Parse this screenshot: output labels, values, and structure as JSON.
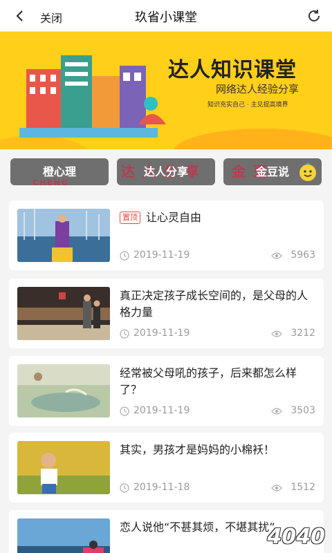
{
  "header": {
    "close_label": "关闭",
    "title": "玖省小课堂"
  },
  "banner": {
    "headline": "达人知识课堂",
    "subtitle": "网络达人经验分享",
    "tagline": "知识充实自己 · 主见提高境界"
  },
  "tabs": [
    {
      "label": "橙心理",
      "ghost": "CHENG"
    },
    {
      "label": "达人分享",
      "ghost": "达 人 分 享"
    },
    {
      "label": "金豆说",
      "ghost": "金 豆"
    }
  ],
  "articles": [
    {
      "pinned": true,
      "pin_label": "置顶",
      "title": "让心灵自由",
      "date": "2019-11-19",
      "views": "5963"
    },
    {
      "pinned": false,
      "title": "真正决定孩子成长空间的，是父母的人格力量",
      "date": "2019-11-19",
      "views": "3212"
    },
    {
      "pinned": false,
      "title": "经常被父母吼的孩子，后来都怎么样了？",
      "date": "2019-11-19",
      "views": "3503"
    },
    {
      "pinned": false,
      "title": "其实，男孩才是妈妈的小棉袄！",
      "date": "2019-11-18",
      "views": "1512"
    },
    {
      "pinned": false,
      "title": "恋人说他“不甚其烦，不堪其扰”",
      "date": "",
      "views": ""
    }
  ],
  "watermark": "4040"
}
